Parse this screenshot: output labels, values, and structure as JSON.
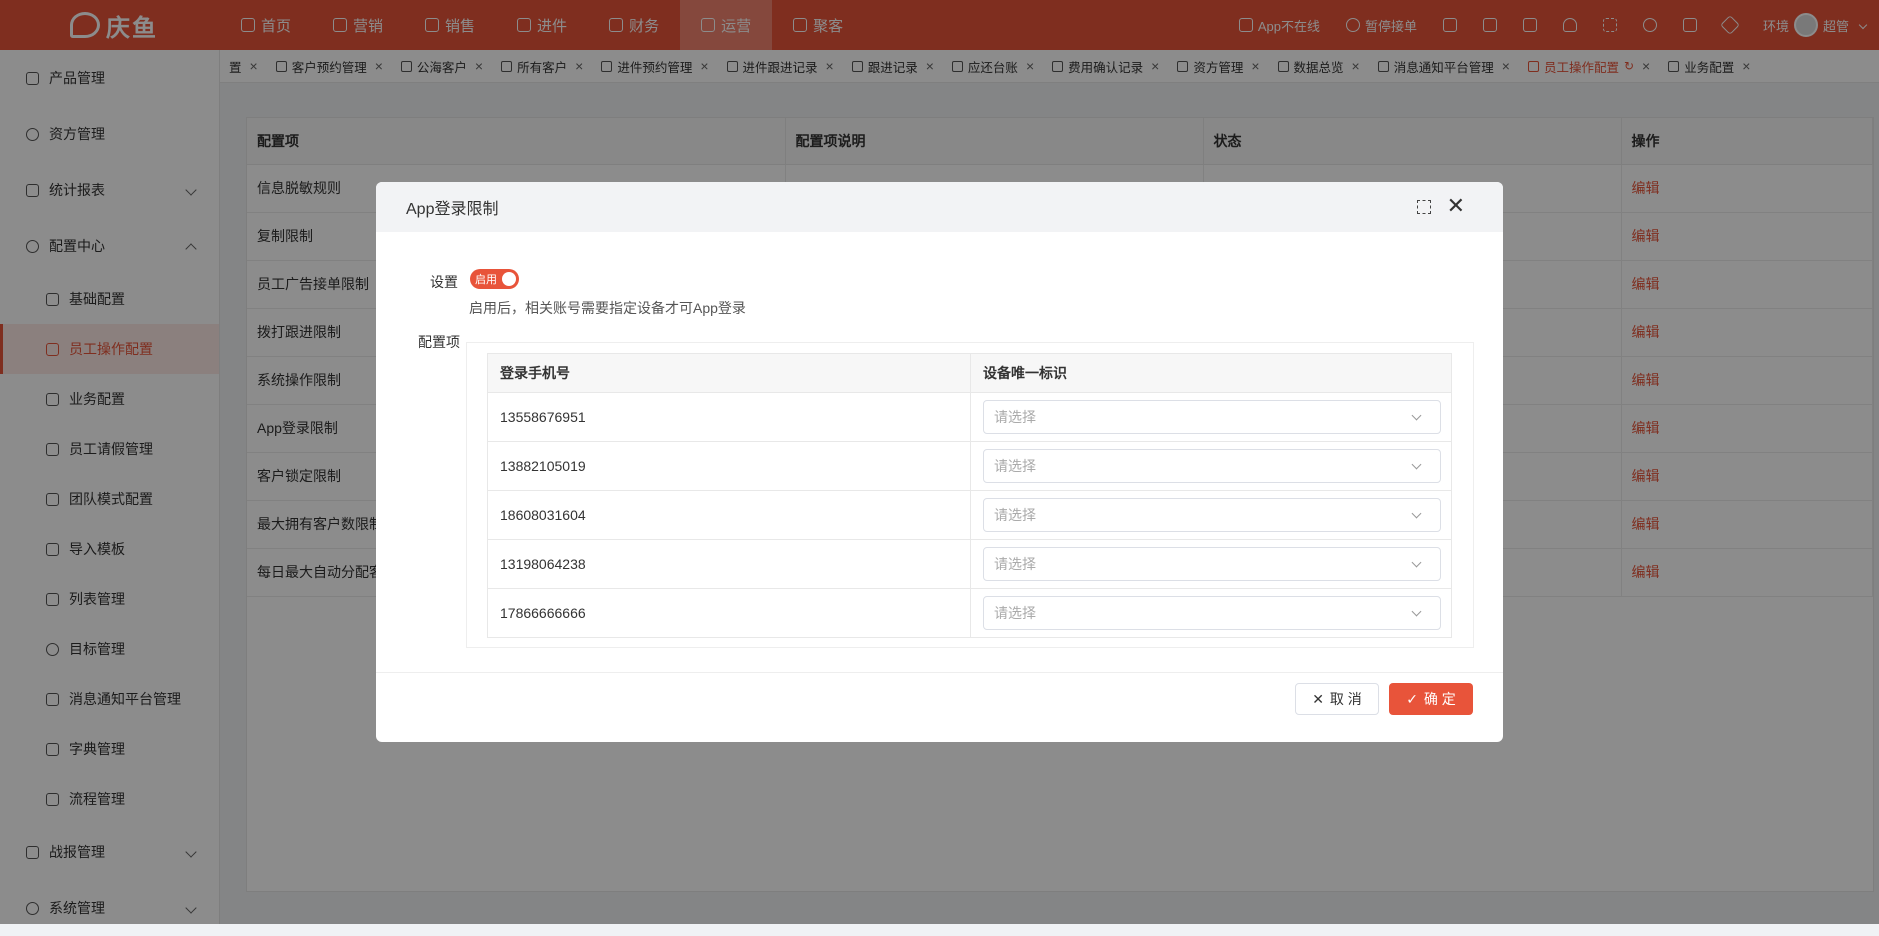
{
  "topbar": {
    "logo": "庆鱼",
    "nav": [
      "首页",
      "营销",
      "销售",
      "进件",
      "财务",
      "运营",
      "聚客"
    ],
    "active_nav": "运营",
    "tools": [
      "App不在线",
      "暂停接单"
    ],
    "user_location": "环境",
    "user_name": "超管"
  },
  "sidebar": {
    "items": [
      {
        "label": "产品管理",
        "icon": "product-icon"
      },
      {
        "label": "资方管理",
        "icon": "funder-icon"
      },
      {
        "label": "统计报表",
        "icon": "report-icon",
        "expandable": true
      },
      {
        "label": "配置中心",
        "icon": "config-icon",
        "expanded": true
      }
    ],
    "sub_items": [
      "基础配置",
      "员工操作配置",
      "业务配置",
      "员工请假管理",
      "团队模式配置",
      "导入模板",
      "列表管理",
      "目标管理",
      "消息通知平台管理",
      "字典管理",
      "流程管理"
    ],
    "active_sub": "员工操作配置",
    "bottom_items": [
      "战报管理",
      "系统管理"
    ]
  },
  "tabs": [
    "置",
    "客户预约管理",
    "公海客户",
    "所有客户",
    "进件预约管理",
    "进件跟进记录",
    "跟进记录",
    "应还台账",
    "费用确认记录",
    "资方管理",
    "数据总览",
    "消息通知平台管理",
    "员工操作配置",
    "业务配置"
  ],
  "active_tab": "员工操作配置",
  "main_table": {
    "headers": [
      "配置项",
      "配置项说明",
      "状态",
      "操作"
    ],
    "rows": [
      "信息脱敏规则",
      "复制限制",
      "员工广告接单限制",
      "拨打跟进限制",
      "系统操作限制",
      "App登录限制",
      "客户锁定限制",
      "最大拥有客户数限制",
      "每日最大自动分配客"
    ],
    "action_label": "编辑"
  },
  "modal": {
    "title": "App登录限制",
    "setting_label": "设置",
    "switch_label": "启用",
    "hint": "启用后，相关账号需要指定设备才可App登录",
    "config_label": "配置项",
    "headers": [
      "登录手机号",
      "设备唯一标识"
    ],
    "rows": [
      {
        "phone": "13558676951",
        "placeholder": "请选择"
      },
      {
        "phone": "13882105019",
        "placeholder": "请选择"
      },
      {
        "phone": "18608031604",
        "placeholder": "请选择"
      },
      {
        "phone": "13198064238",
        "placeholder": "请选择"
      },
      {
        "phone": "17866666666",
        "placeholder": "请选择"
      }
    ],
    "cancel_label": "取 消",
    "ok_label": "确 定"
  }
}
